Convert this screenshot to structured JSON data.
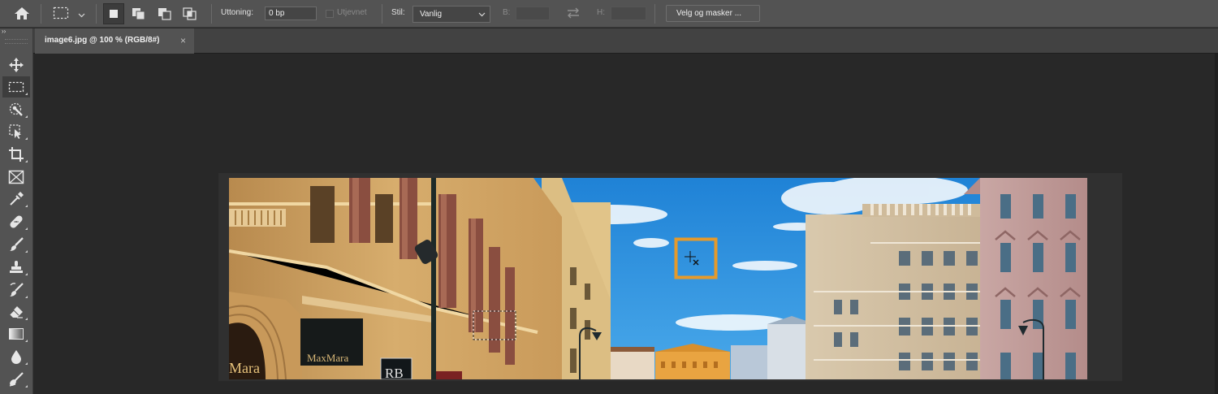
{
  "options_bar": {
    "feather_label": "Uttoning:",
    "feather_value": "0 bp",
    "antialias_label": "Utjevnet",
    "style_label": "Stil:",
    "style_value": "Vanlig",
    "width_label": "B:",
    "height_label": "H:",
    "select_mask_label": "Velg og masker ..."
  },
  "document_tab": {
    "title": "image6.jpg @ 100 % (RGB/8#)",
    "close_glyph": "×"
  },
  "toolbar": {
    "collapse_glyph": "››",
    "tools": [
      "move-tool",
      "rectangular-marquee-tool",
      "quick-selection-tool",
      "object-selection-tool",
      "crop-tool",
      "frame-tool",
      "eyedropper-tool",
      "spot-healing-brush-tool",
      "brush-tool",
      "clone-stamp-tool",
      "history-brush-tool",
      "eraser-tool",
      "gradient-tool",
      "blur-tool",
      "dodge-tool"
    ]
  },
  "photo": {
    "shop_sign": "MaxMara",
    "arch_sign": "Mara",
    "monogram": "RB"
  },
  "colors": {
    "ui_panel": "#535353",
    "workspace": "#282828",
    "highlight": "#e59a2b",
    "sky": "#2a8ad8"
  }
}
